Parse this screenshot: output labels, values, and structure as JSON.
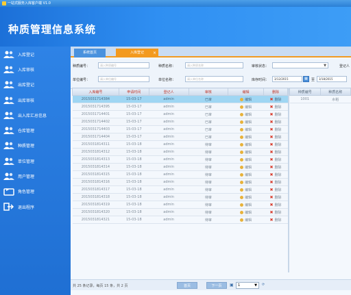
{
  "window": {
    "title": "一站式服务入库客户端 V1.0"
  },
  "banner": {
    "title": "种质管理信息系统"
  },
  "sidebar": {
    "items": [
      {
        "label": "入库登记",
        "icon": "users-icon"
      },
      {
        "label": "入库审核",
        "icon": "users-icon"
      },
      {
        "label": "出库登记",
        "icon": "users-icon"
      },
      {
        "label": "出库审核",
        "icon": "users-icon"
      },
      {
        "label": "出入库汇总信息",
        "icon": "users-icon"
      },
      {
        "label": "仓库管理",
        "icon": "users-icon"
      },
      {
        "label": "种质管理",
        "icon": "users-icon"
      },
      {
        "label": "单位管理",
        "icon": "users-icon"
      },
      {
        "label": "用户管理",
        "icon": "users-icon"
      },
      {
        "label": "角色管理",
        "icon": "refresh-icon"
      },
      {
        "label": "退出程序",
        "icon": "exit-icon"
      }
    ]
  },
  "tabs": {
    "first": "系统首页",
    "second": "入库登记",
    "close": "×"
  },
  "filters": {
    "germplasm_no_label": "种质编号：",
    "germplasm_no_placeholder": "请入种质编号",
    "germplasm_name_label": "种质名称：",
    "germplasm_name_placeholder": "请入种质名称",
    "audit_status_label": "审核状态：",
    "registrant_label": "登记人",
    "unit_no_label": "单位编号：",
    "unit_no_placeholder": "请入单位编号",
    "unit_name_label": "单位名称：",
    "unit_name_placeholder": "请入单位名称",
    "storage_time_label": "库存时间：",
    "date_from": "3/12/2015",
    "date_to_label": "至",
    "date_to": "3/18/2015"
  },
  "table": {
    "columns": [
      "入库编号",
      "申请时间",
      "登记人",
      "审核",
      "编辑",
      "删除"
    ],
    "rows": [
      [
        "2015031714384",
        "15-03-17",
        "admin",
        "已审",
        "编辑",
        "删除"
      ],
      [
        "2015031714395",
        "15-03-17",
        "admin",
        "已审",
        "编辑",
        "删除"
      ],
      [
        "2015031714401",
        "15-03-17",
        "admin",
        "已审",
        "编辑",
        "删除"
      ],
      [
        "2015031714402",
        "15-03-17",
        "admin",
        "已审",
        "编辑",
        "删除"
      ],
      [
        "2015031714403",
        "15-03-17",
        "admin",
        "已审",
        "编辑",
        "删除"
      ],
      [
        "2015031714404",
        "15-03-17",
        "admin",
        "已审",
        "编辑",
        "删除"
      ],
      [
        "2015031814311",
        "15-03-18",
        "admin",
        "待审",
        "编辑",
        "删除"
      ],
      [
        "2015031814312",
        "15-03-18",
        "admin",
        "待审",
        "编辑",
        "删除"
      ],
      [
        "2015031814313",
        "15-03-18",
        "admin",
        "待审",
        "编辑",
        "删除"
      ],
      [
        "2015031814314",
        "15-03-18",
        "admin",
        "待审",
        "编辑",
        "删除"
      ],
      [
        "2015031814315",
        "15-03-18",
        "admin",
        "待审",
        "编辑",
        "删除"
      ],
      [
        "2015031814316",
        "15-03-18",
        "admin",
        "待审",
        "编辑",
        "删除"
      ],
      [
        "2015031814317",
        "15-03-18",
        "admin",
        "待审",
        "编辑",
        "删除"
      ],
      [
        "2015031814318",
        "15-03-18",
        "admin",
        "待审",
        "编辑",
        "删除"
      ],
      [
        "2015031814319",
        "15-03-18",
        "admin",
        "待审",
        "编辑",
        "删除"
      ],
      [
        "2015031814320",
        "15-03-18",
        "admin",
        "待审",
        "编辑",
        "删除"
      ],
      [
        "2015031814321",
        "15-03-18",
        "admin",
        "待审",
        "编辑",
        "删除"
      ]
    ]
  },
  "detail_table": {
    "columns": [
      "种质编号",
      "种质名称"
    ],
    "rows": [
      [
        "1001",
        "水稻"
      ]
    ]
  },
  "pager": {
    "info": "共 25 条记录，每页 15 条，共 2 页",
    "prev": "首页",
    "next": "下一页",
    "page_value": "1"
  }
}
